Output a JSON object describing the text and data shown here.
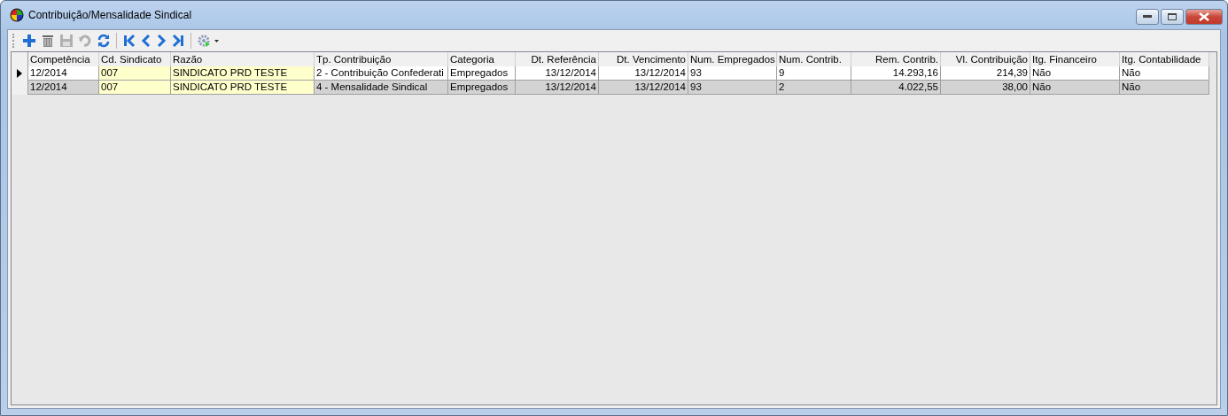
{
  "window": {
    "title": "Contribuição/Mensalidade Sindical"
  },
  "toolbar": [
    {
      "kind": "add",
      "disabled": false
    },
    {
      "kind": "delete",
      "disabled": false
    },
    {
      "kind": "save",
      "disabled": true
    },
    {
      "kind": "undo",
      "disabled": true
    },
    {
      "kind": "refresh",
      "disabled": false
    },
    {
      "kind": "separator"
    },
    {
      "kind": "first",
      "disabled": false
    },
    {
      "kind": "prev",
      "disabled": false
    },
    {
      "kind": "next",
      "disabled": false
    },
    {
      "kind": "last",
      "disabled": false
    },
    {
      "kind": "separator"
    },
    {
      "kind": "gear-menu",
      "disabled": false
    }
  ],
  "table": {
    "columns": [
      {
        "label": "Competência",
        "kind": "text",
        "required": false
      },
      {
        "label": "Cd. Sindicato",
        "kind": "text",
        "required": true
      },
      {
        "label": "Razão",
        "kind": "text",
        "required": true
      },
      {
        "label": "Tp. Contribuição",
        "kind": "text",
        "required": false
      },
      {
        "label": "Categoria",
        "kind": "text",
        "required": false
      },
      {
        "label": "Dt. Referência",
        "kind": "date",
        "required": false
      },
      {
        "label": "Dt. Vencimento",
        "kind": "date",
        "required": false
      },
      {
        "label": "Num. Empregados",
        "kind": "text",
        "required": false
      },
      {
        "label": "Num. Contrib.",
        "kind": "text",
        "required": false
      },
      {
        "label": "Rem. Contrib.",
        "kind": "money",
        "required": false
      },
      {
        "label": "Vl. Contribuição",
        "kind": "money",
        "required": false
      },
      {
        "label": "Itg. Financeiro",
        "kind": "text",
        "required": false
      },
      {
        "label": "Itg. Contabilidade",
        "kind": "text",
        "required": false
      }
    ],
    "rows": [
      {
        "current": true,
        "selected": false,
        "cells": [
          "12/2014",
          "007",
          "SINDICATO PRD TESTE",
          "2 - Contribuição Confederati",
          "Empregados",
          "13/12/2014",
          "13/12/2014",
          "93",
          "9",
          "14.293,16",
          "214,39",
          "Não",
          "Não"
        ]
      },
      {
        "current": false,
        "selected": true,
        "cells": [
          "12/2014",
          "007",
          "SINDICATO PRD TESTE",
          "4 - Mensalidade Sindical",
          "Empregados",
          "13/12/2014",
          "13/12/2014",
          "93",
          "2",
          "4.022,55",
          "38,00",
          "Não",
          "Não"
        ]
      }
    ]
  }
}
